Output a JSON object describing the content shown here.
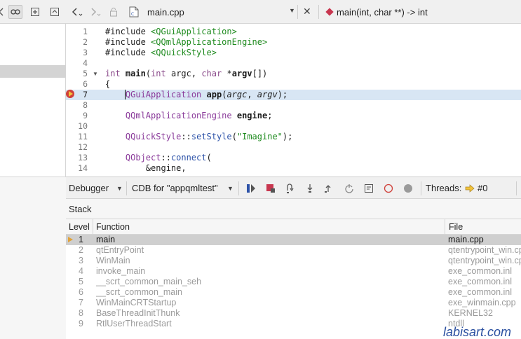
{
  "editor": {
    "file_name": "main.cpp",
    "symbol": "main(int, char **) -> int",
    "current_line": 7,
    "lines": [
      {
        "n": "1",
        "html": "#include <span class='inc'>&lt;QGuiApplication&gt;</span>"
      },
      {
        "n": "2",
        "html": "#include <span class='inc'>&lt;QQmlApplicationEngine&gt;</span>"
      },
      {
        "n": "3",
        "html": "#include <span class='inc'>&lt;QQuickStyle&gt;</span>"
      },
      {
        "n": "4",
        "html": ""
      },
      {
        "n": "5",
        "html": "<span class='kw'>int</span> <span class='fn'>main</span>(<span class='kw'>int</span> argc, <span class='kw'>char</span> *<span class='fn'>argv</span>[])",
        "fold": true
      },
      {
        "n": "6",
        "html": "{"
      },
      {
        "n": "7",
        "html": "    <span class='typ'>QGuiApplication</span> <span class='fn'>app</span>(<span class='it'>argc</span>, <span class='it'>argv</span>);"
      },
      {
        "n": "8",
        "html": ""
      },
      {
        "n": "9",
        "html": "    <span class='typ'>QQmlApplicationEngine</span> <span class='fn'>engine</span>;"
      },
      {
        "n": "10",
        "html": ""
      },
      {
        "n": "11",
        "html": "    <span class='typ'>QQuickStyle</span>::<span class='meth'>setStyle</span>(<span class='str'>\"Imagine\"</span>);"
      },
      {
        "n": "12",
        "html": ""
      },
      {
        "n": "13",
        "html": "    <span class='typ'>QObject</span>::<span class='meth'>connect</span>("
      },
      {
        "n": "14",
        "html": "        &amp;engine,"
      }
    ]
  },
  "debugger": {
    "mode_label": "Debugger",
    "engine_label": "CDB for \"appqmltest\"",
    "threads_label": "Threads:",
    "thread_value": "#0"
  },
  "stack": {
    "title": "Stack",
    "columns": {
      "level": "Level",
      "function": "Function",
      "file": "File"
    },
    "rows": [
      {
        "level": "1",
        "function": "main",
        "file": "main.cpp"
      },
      {
        "level": "2",
        "function": "qtEntryPoint",
        "file": "qtentrypoint_win.cpp"
      },
      {
        "level": "3",
        "function": "WinMain",
        "file": "qtentrypoint_win.cpp"
      },
      {
        "level": "4",
        "function": "invoke_main",
        "file": "exe_common.inl"
      },
      {
        "level": "5",
        "function": "__scrt_common_main_seh",
        "file": "exe_common.inl"
      },
      {
        "level": "6",
        "function": "__scrt_common_main",
        "file": "exe_common.inl"
      },
      {
        "level": "7",
        "function": "WinMainCRTStartup",
        "file": "exe_winmain.cpp"
      },
      {
        "level": "8",
        "function": "BaseThreadInitThunk",
        "file": "KERNEL32"
      },
      {
        "level": "9",
        "function": "RtlUserThreadStart",
        "file": "ntdll"
      }
    ]
  },
  "watermark": "labisart.com",
  "colors": {
    "current_line": "#d8e6f4",
    "selected_row": "#cfcfcf",
    "breakpoint": "#d0403a",
    "exec_arrow": "#f2c33b"
  }
}
